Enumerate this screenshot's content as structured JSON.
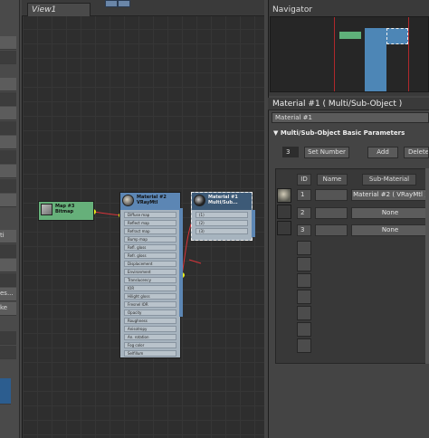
{
  "viewport": {
    "tab_label": "View1"
  },
  "left_panel": {
    "items": [
      "ti",
      "es...",
      "ke"
    ]
  },
  "nodes": {
    "bitmap": {
      "title": "Map #3",
      "subtitle": "Bitmap"
    },
    "vray": {
      "title": "Material #2",
      "subtitle": "VRayMtl",
      "slots": [
        "Diffuse map",
        "Reflect map",
        "Refract map",
        "Bump map",
        "Refl. gloss",
        "Refr. gloss",
        "Displacement",
        "Environment",
        "Translucency",
        "IOR",
        "Hilight gloss",
        "Fresnel IOR",
        "Opacity",
        "Roughness",
        "Anisotropy",
        "An. rotation",
        "Fog color",
        "Selfillum"
      ]
    },
    "multi": {
      "title": "Material #1",
      "subtitle": "Multi/Sub...",
      "slots": [
        "(1)",
        "(2)",
        "(3)"
      ]
    }
  },
  "navigator": {
    "title": "Navigator"
  },
  "material_editor": {
    "title": "Material #1  ( Multi/Sub-Object )",
    "name_value": "Material #1",
    "rollout_title": "Multi/Sub-Object Basic Parameters",
    "count_value": "3",
    "set_number_label": "Set Number",
    "add_label": "Add",
    "delete_label": "Delete",
    "columns": {
      "id": "ID",
      "name": "Name",
      "sub": "Sub-Material"
    },
    "rows": [
      {
        "id": "1",
        "sub": "Material #2  ( VRayMtl )"
      },
      {
        "id": "2",
        "sub": "None"
      },
      {
        "id": "3",
        "sub": "None"
      }
    ]
  },
  "colors": {
    "accent_blue": "#2c5d8f",
    "wire_red": "#d8343a",
    "socket_yellow": "#e7ef1b",
    "bitmap_header": "#66b07a",
    "vray_header": "#5c86b4",
    "multi_header": "#3d5a77"
  }
}
